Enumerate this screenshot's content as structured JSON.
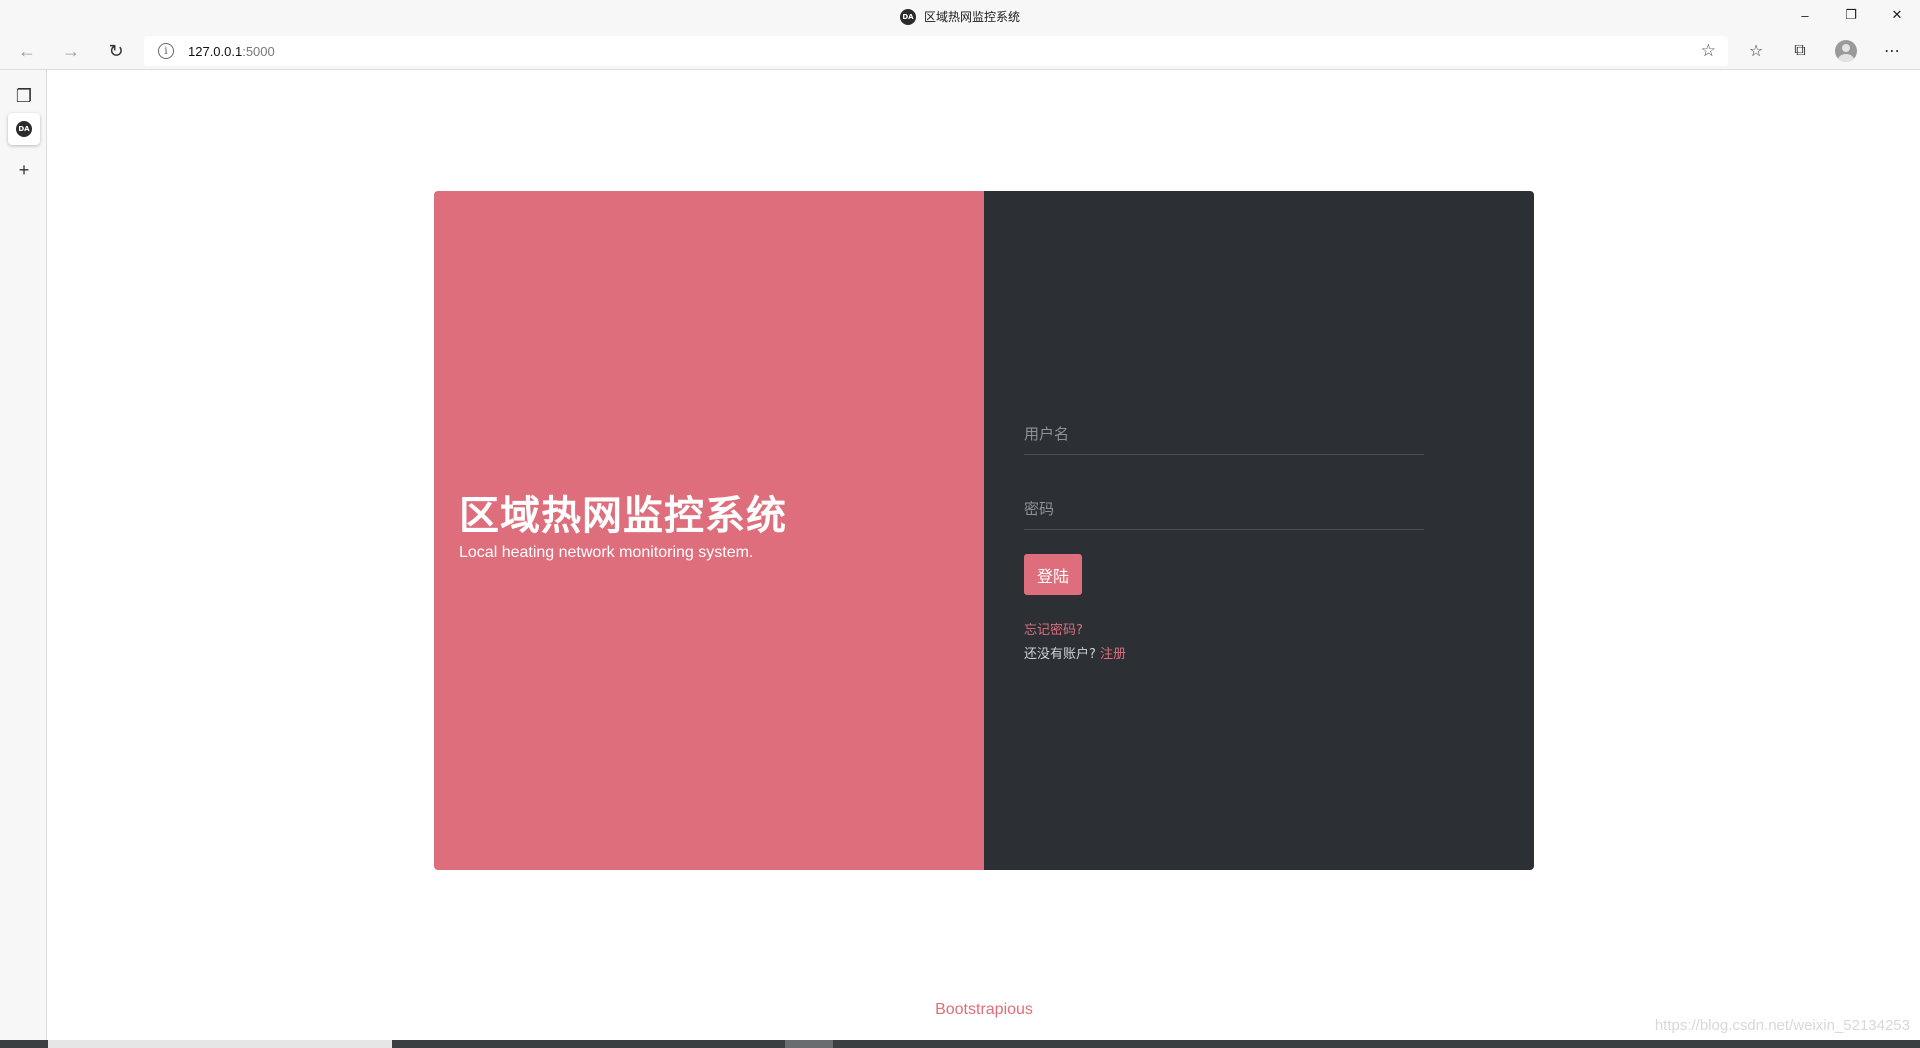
{
  "browser": {
    "tab_title": "区域热网监控系统",
    "favicon_text": "DA",
    "url_host": "127.0.0.1",
    "url_port": ":5000",
    "vertical_tab_favicon_text": "DA"
  },
  "login_page": {
    "title": "区域热网监控系统",
    "subtitle": "Local heating network monitoring system.",
    "username_placeholder": "用户名",
    "password_placeholder": "密码",
    "login_button": "登陆",
    "forgot_password": "忘记密码?",
    "no_account_text": "还没有账户?",
    "register_link": "注册",
    "footer_text": "Bootstrapious",
    "colors": {
      "accent": "#de6e7b",
      "dark_panel": "#2c2f34"
    }
  },
  "watermark": "https://blog.csdn.net/weixin_52134253"
}
